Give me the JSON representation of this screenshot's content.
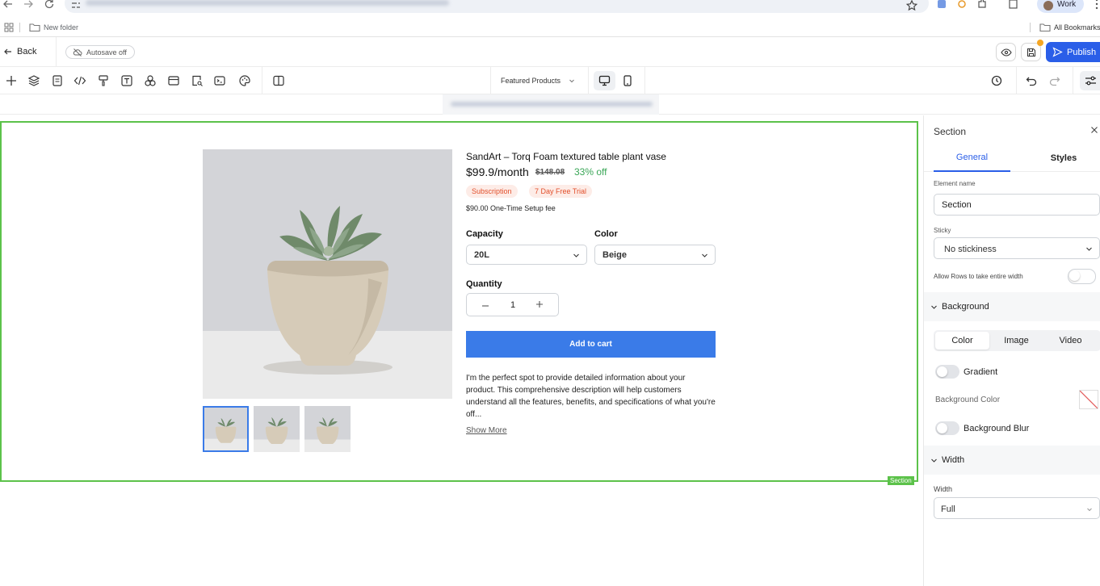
{
  "browser": {
    "profile_label": "Work",
    "bookmark_folder": "New folder",
    "all_bookmarks": "All Bookmarks"
  },
  "topbar": {
    "back_label": "Back",
    "autosave_label": "Autosave off",
    "publish_label": "Publish"
  },
  "toolbar": {
    "page_selector": "Featured Products"
  },
  "product": {
    "title": "SandArt – Torq Foam textured table plant vase",
    "price": "$99.9/month",
    "old_price": "$148.08",
    "discount": "33% off",
    "badges": [
      "Subscription",
      "7 Day Free Trial"
    ],
    "setup_fee": "$90.00 One-Time Setup fee",
    "capacity_label": "Capacity",
    "capacity_value": "20L",
    "color_label": "Color",
    "color_value": "Beige",
    "quantity_label": "Quantity",
    "quantity_value": "1",
    "add_to_cart": "Add to cart",
    "description": "I'm the perfect spot to provide detailed information about your product. This comprehensive description will help customers understand all the features, benefits, and specifications of what you're off...",
    "show_more": "Show More",
    "section_tag": "Section"
  },
  "panel": {
    "title": "Section",
    "tabs": [
      "General",
      "Styles"
    ],
    "element_name_label": "Element name",
    "element_name_value": "Section",
    "sticky_label": "Sticky",
    "sticky_value": "No stickiness",
    "allow_rows_label": "Allow Rows to take entire width",
    "background_header": "Background",
    "bg_tabs": [
      "Color",
      "Image",
      "Video"
    ],
    "gradient_label": "Gradient",
    "bg_color_label": "Background Color",
    "bg_blur_label": "Background Blur",
    "width_header": "Width",
    "width_label": "Width",
    "width_value": "Full"
  },
  "colors": {
    "accent": "#2a5ee8",
    "section_outline": "#5cc24a",
    "cart_button": "#3a7be8",
    "discount": "#3aa657",
    "badge_bg": "#fdece7",
    "badge_text": "#e2502c"
  }
}
